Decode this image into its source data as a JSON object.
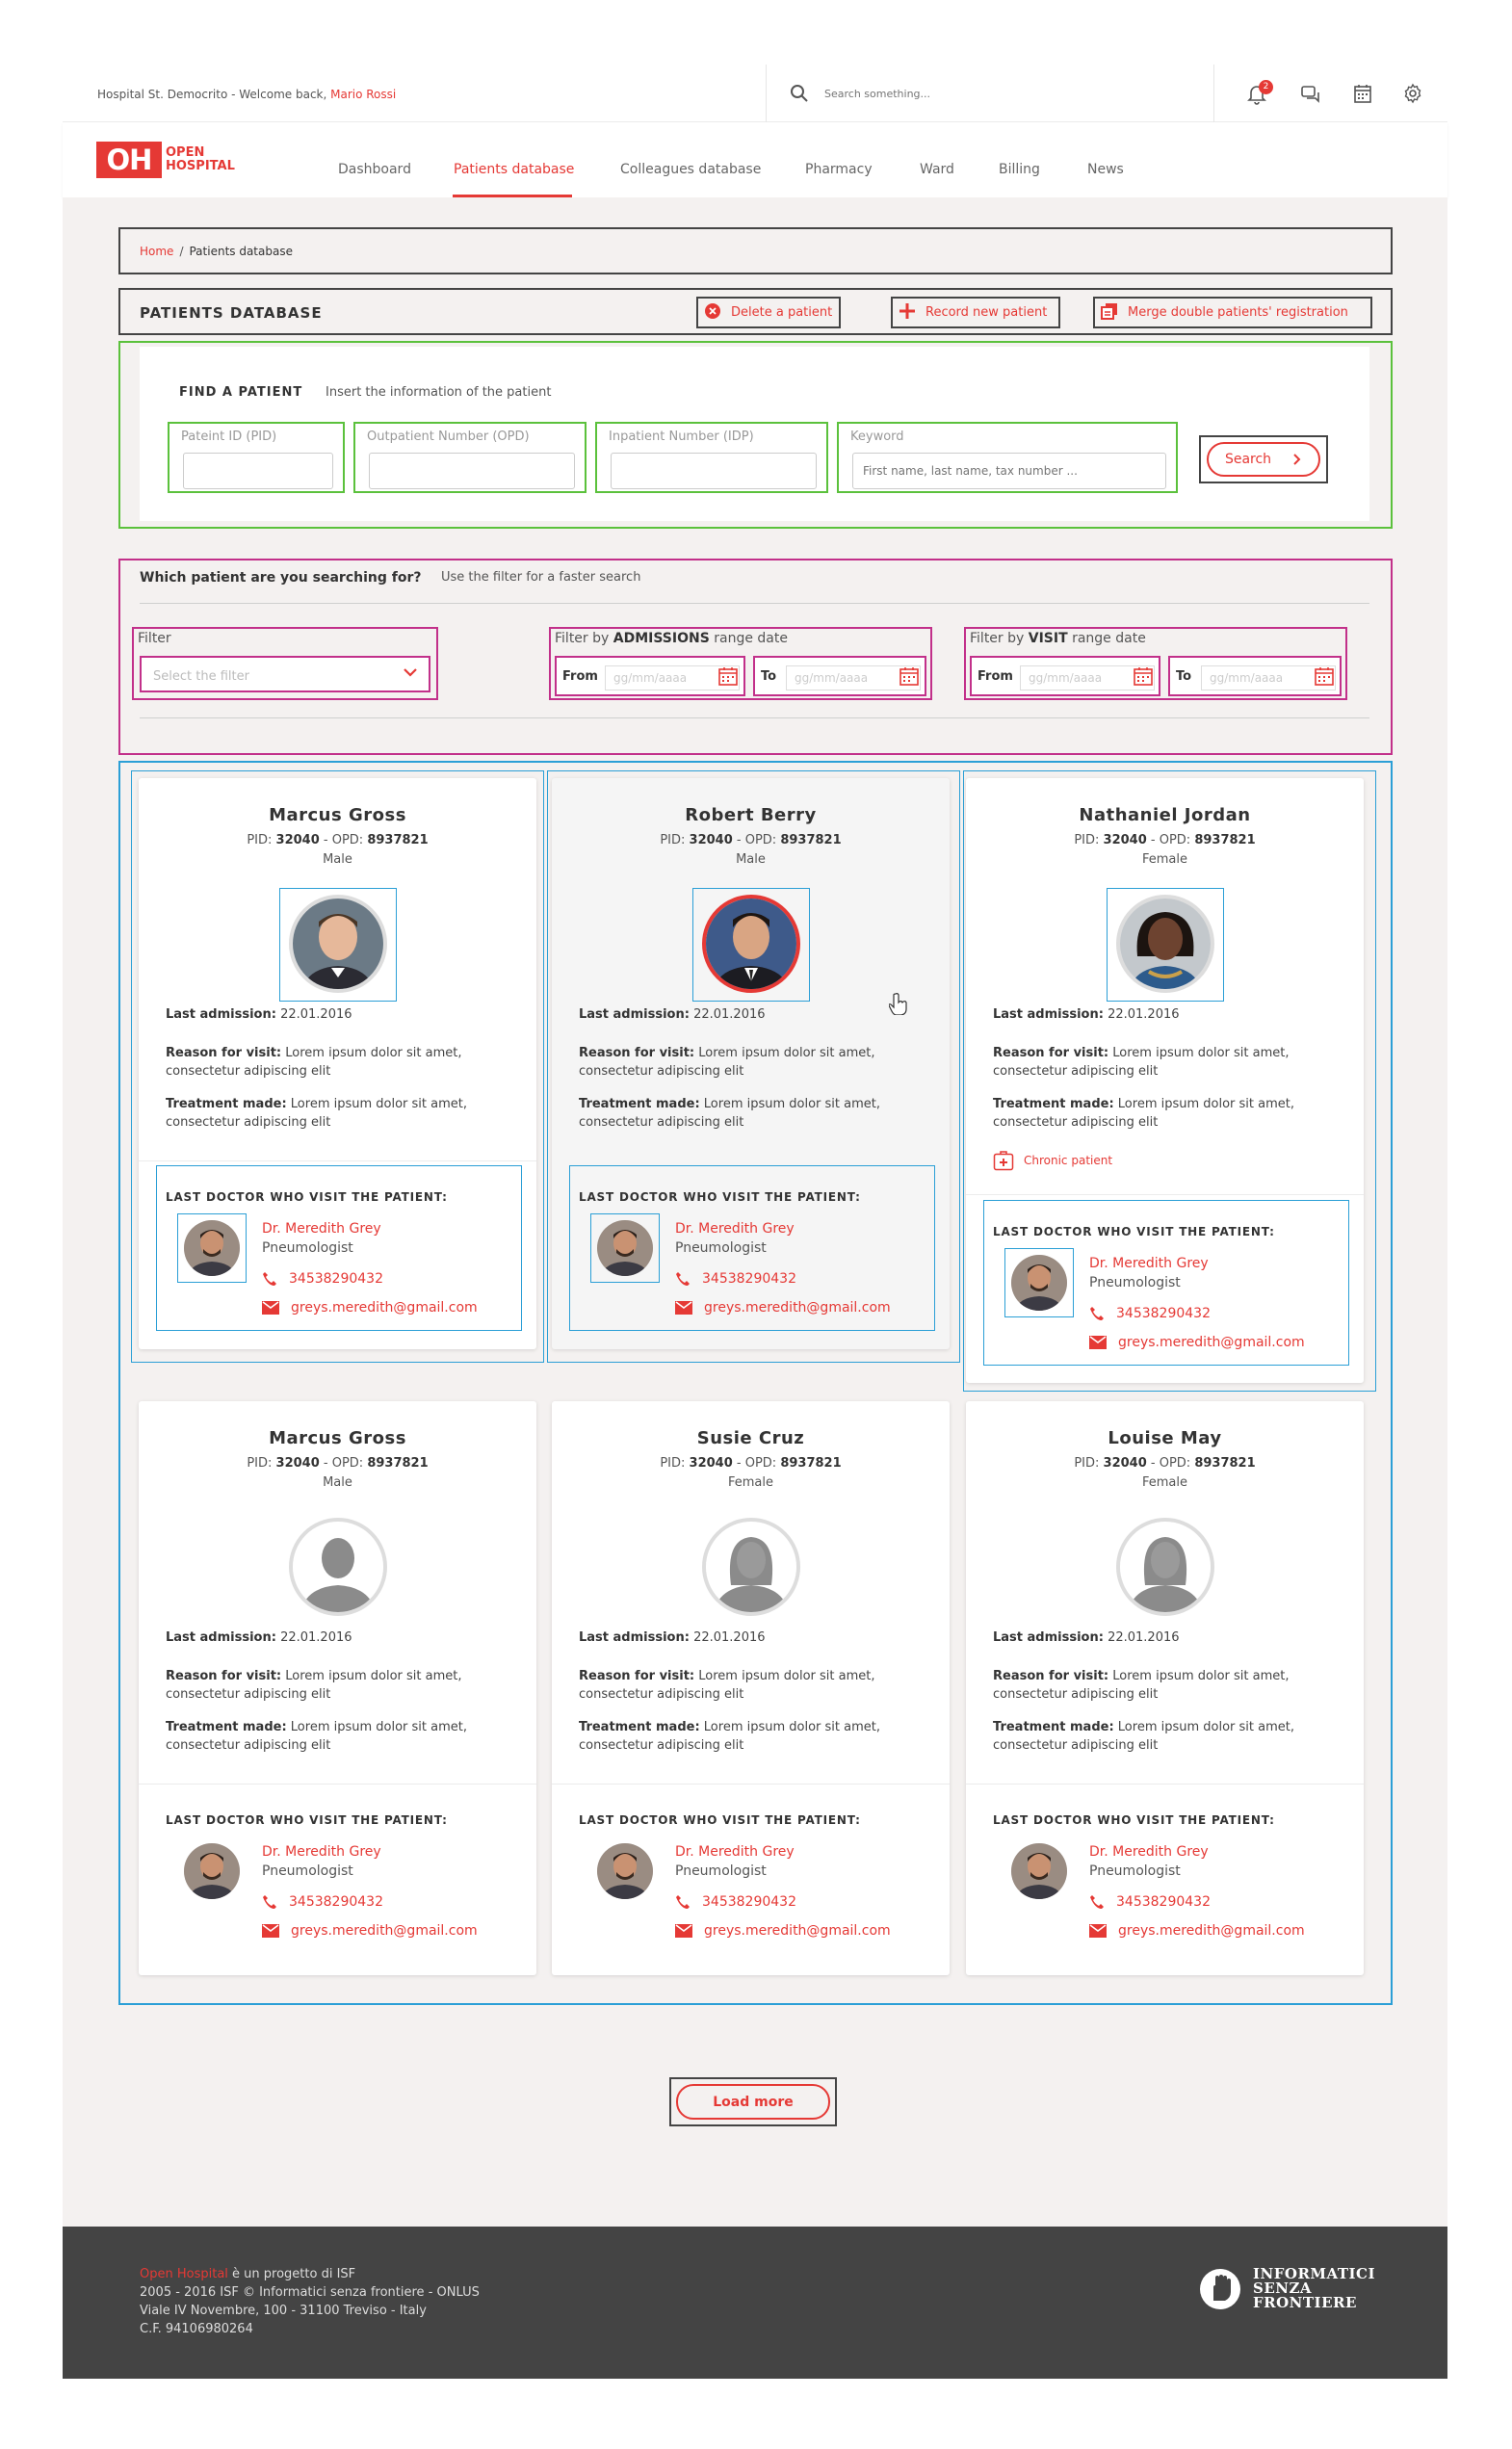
{
  "topbar": {
    "hospital": "Hospital St. Democrito - ",
    "welcome": "Welcome back, ",
    "user": "Mario Rossi",
    "search_placeholder": "Search something...",
    "notification_count": "2"
  },
  "logo": {
    "mark": "OH",
    "line1": "OPEN",
    "line2": "HOSPITAL"
  },
  "nav": [
    "Dashboard",
    "Patients database",
    "Colleagues database",
    "Pharmacy",
    "Ward",
    "Billing",
    "News"
  ],
  "breadcrumb": {
    "home": "Home",
    "separator": "/",
    "current": "Patients database"
  },
  "page_title": "PATIENTS DATABASE",
  "header_buttons": {
    "delete": "Delete a patient",
    "record": "Record new patient",
    "merge": "Merge double patients' registration"
  },
  "find": {
    "title": "FIND A PATIENT",
    "subtitle": "Insert the information of the patient",
    "fields": [
      {
        "label": "Pateint ID (PID)",
        "placeholder": ""
      },
      {
        "label": "Outpatient Number (OPD)",
        "placeholder": ""
      },
      {
        "label": "Inpatient Number (IDP)",
        "placeholder": ""
      },
      {
        "label": "Keyword",
        "placeholder": "First name, last name, tax number ..."
      }
    ],
    "search_button": "Search"
  },
  "filter": {
    "question": "Which patient are you searching for?",
    "hint": "Use the filter for a faster search",
    "filter_label": "Filter",
    "filter_placeholder": "Select the filter",
    "admissions_prefix": "Filter by ",
    "admissions_bold": "ADMISSIONS",
    "admissions_suffix": " range date",
    "visit_prefix": "Filter by ",
    "visit_bold": "VISIT",
    "visit_suffix": " range date",
    "from": "From",
    "to": "To",
    "date_placeholder": "gg/mm/aaaa"
  },
  "labels": {
    "pid": "PID: ",
    "opd": " - OPD: ",
    "last_admission": "Last admission:",
    "reason": "Reason for visit:",
    "treatment": "Treatment made:",
    "last_doctor": "LAST DOCTOR WHO VISIT THE PATIENT:",
    "chronic": "Chronic patient"
  },
  "patients": [
    {
      "name": "Marcus Gross",
      "pid": "32040",
      "opd": "8937821",
      "gender": "Male",
      "last_admission": "22.01.2016",
      "reason": "Lorem ipsum dolor sit amet, consectetur adipiscing elit",
      "treatment": "Lorem ipsum dolor sit amet, consectetur adipiscing elit",
      "doctor": "Dr. Meredith Grey",
      "specialty": "Pneumologist",
      "phone": "34538290432",
      "email": "greys.meredith@gmail.com"
    },
    {
      "name": "Robert Berry",
      "pid": "32040",
      "opd": "8937821",
      "gender": "Male",
      "last_admission": "22.01.2016",
      "reason": "Lorem ipsum dolor sit amet, consectetur adipiscing elit",
      "treatment": "Lorem ipsum dolor sit amet, consectetur adipiscing elit",
      "doctor": "Dr. Meredith Grey",
      "specialty": "Pneumologist",
      "phone": "34538290432",
      "email": "greys.meredith@gmail.com"
    },
    {
      "name": "Nathaniel Jordan",
      "pid": "32040",
      "opd": "8937821",
      "gender": "Female",
      "last_admission": "22.01.2016",
      "reason": "Lorem ipsum dolor sit amet, consectetur adipiscing elit",
      "treatment": "Lorem ipsum dolor sit amet, consectetur adipiscing elit",
      "doctor": "Dr. Meredith Grey",
      "specialty": "Pneumologist",
      "phone": "34538290432",
      "email": "greys.meredith@gmail.com"
    },
    {
      "name": "Marcus Gross",
      "pid": "32040",
      "opd": "8937821",
      "gender": "Male",
      "last_admission": "22.01.2016",
      "reason": "Lorem ipsum dolor sit amet, consectetur adipiscing elit",
      "treatment": "Lorem ipsum dolor sit amet, consectetur adipiscing elit",
      "doctor": "Dr. Meredith Grey",
      "specialty": "Pneumologist",
      "phone": "34538290432",
      "email": "greys.meredith@gmail.com"
    },
    {
      "name": "Susie Cruz",
      "pid": "32040",
      "opd": "8937821",
      "gender": "Female",
      "last_admission": "22.01.2016",
      "reason": "Lorem ipsum dolor sit amet, consectetur adipiscing elit",
      "treatment": "Lorem ipsum dolor sit amet, consectetur adipiscing elit",
      "doctor": "Dr. Meredith Grey",
      "specialty": "Pneumologist",
      "phone": "34538290432",
      "email": "greys.meredith@gmail.com"
    },
    {
      "name": "Louise May",
      "pid": "32040",
      "opd": "8937821",
      "gender": "Female",
      "last_admission": "22.01.2016",
      "reason": "Lorem ipsum dolor sit amet, consectetur adipiscing elit",
      "treatment": "Lorem ipsum dolor sit amet, consectetur adipiscing elit",
      "doctor": "Dr. Meredith Grey",
      "specialty": "Pneumologist",
      "phone": "34538290432",
      "email": "greys.meredith@gmail.com"
    }
  ],
  "load_more": "Load more",
  "footer": {
    "brand": "Open Hospital",
    "project": " è un progetto di ISF",
    "line2": "2005 - 2016 ISF © Informatici senza frontiere - ONLUS",
    "line3": "Viale IV Novembre, 100 - 31100 Treviso - Italy",
    "line4": "C.F. 94106980264",
    "isf_logo": [
      "INFORMATICI",
      "SENZA",
      "FRONTIERE"
    ]
  },
  "colors": {
    "accent": "#e53935",
    "find_outline": "#5bc13c",
    "filter_outline": "#c2308a",
    "card_outline": "#2b9fd6",
    "background": "#f4f1f0",
    "footer": "#444444"
  }
}
